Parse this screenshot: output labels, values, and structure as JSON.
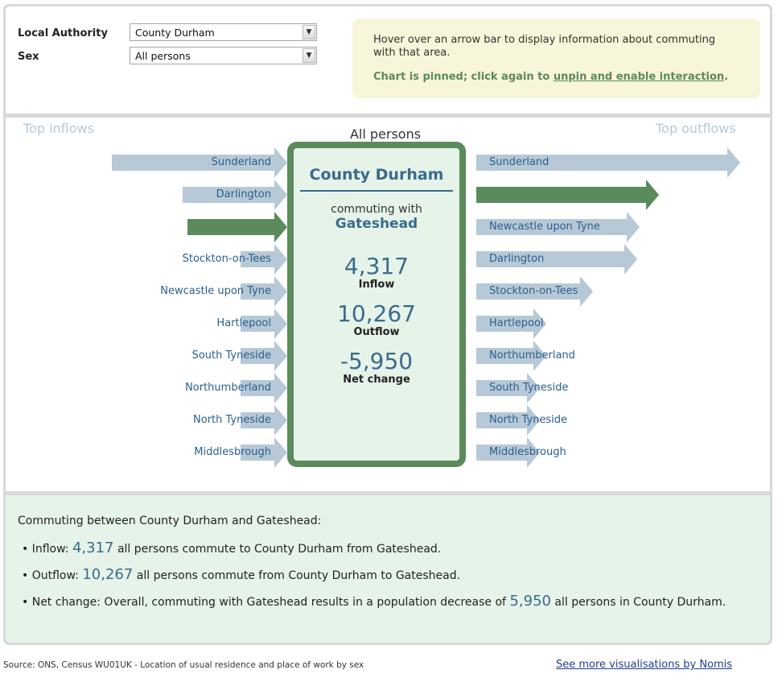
{
  "controls": {
    "local_authority_label": "Local Authority",
    "local_authority_value": "County Durham",
    "sex_label": "Sex",
    "sex_value": "All persons"
  },
  "info": {
    "hover_text": "Hover over an arrow bar to display information about commuting with that area.",
    "pin_prefix": "Chart is pinned; click again to ",
    "pin_link": "unpin and enable interaction",
    "pin_suffix": "."
  },
  "chart": {
    "title": "All persons",
    "inflows_header": "Top inflows",
    "outflows_header": "Top outflows",
    "inflows": [
      {
        "name": "Sunderland",
        "rel": 1.0,
        "selected": false
      },
      {
        "name": "Darlington",
        "rel": 0.51,
        "selected": false
      },
      {
        "name": "",
        "rel": 0.48,
        "selected": true
      },
      {
        "name": "Stockton-on-Tees",
        "rel": 0.11,
        "selected": false
      },
      {
        "name": "Newcastle upon Tyne",
        "rel": 0.11,
        "selected": false
      },
      {
        "name": "Hartlepool",
        "rel": 0.11,
        "selected": false
      },
      {
        "name": "South Tyneside",
        "rel": 0.11,
        "selected": false
      },
      {
        "name": "Northumberland",
        "rel": 0.11,
        "selected": false
      },
      {
        "name": "North Tyneside",
        "rel": 0.11,
        "selected": false
      },
      {
        "name": "Middlesbrough",
        "rel": 0.11,
        "selected": false
      }
    ],
    "outflows": [
      {
        "name": "Sunderland",
        "rel": 1.0,
        "selected": false
      },
      {
        "name": "",
        "rel": 0.65,
        "selected": true
      },
      {
        "name": "Newcastle upon Tyne",
        "rel": 0.57,
        "selected": false
      },
      {
        "name": "Darlington",
        "rel": 0.56,
        "selected": false
      },
      {
        "name": "Stockton-on-Tees",
        "rel": 0.37,
        "selected": false
      },
      {
        "name": "Hartlepool",
        "rel": 0.17,
        "selected": false
      },
      {
        "name": "Northumberland",
        "rel": 0.17,
        "selected": false
      },
      {
        "name": "South Tyneside",
        "rel": 0.14,
        "selected": false
      },
      {
        "name": "North Tyneside",
        "rel": 0.14,
        "selected": false
      },
      {
        "name": "Middlesbrough",
        "rel": 0.14,
        "selected": false
      }
    ]
  },
  "center": {
    "area": "County Durham",
    "commuting_with": "commuting with",
    "partner": "Gateshead",
    "inflow_value": "4,317",
    "inflow_label": "Inflow",
    "outflow_value": "10,267",
    "outflow_label": "Outflow",
    "net_value": "-5,950",
    "net_label": "Net change"
  },
  "summary": {
    "heading": "Commuting between County Durham and Gateshead:",
    "inflow_prefix": "Inflow: ",
    "inflow_value": "4,317",
    "inflow_suffix": " all persons commute to County Durham from Gateshead.",
    "outflow_prefix": "Outflow: ",
    "outflow_value": "10,267",
    "outflow_suffix": " all persons commute from County Durham to Gateshead.",
    "net_prefix": "Net change: Overall, commuting with Gateshead results in a population decrease of ",
    "net_value": "5,950",
    "net_suffix": " all persons in County Durham."
  },
  "footer": {
    "source": "Source: ONS, Census WU01UK - Location of usual residence and place of work by sex",
    "more_link": "See more visualisations by Nomis"
  },
  "colors": {
    "arrow": "#b7c8d6",
    "selected": "#5b8a5c",
    "label": "#2a5f8f"
  }
}
